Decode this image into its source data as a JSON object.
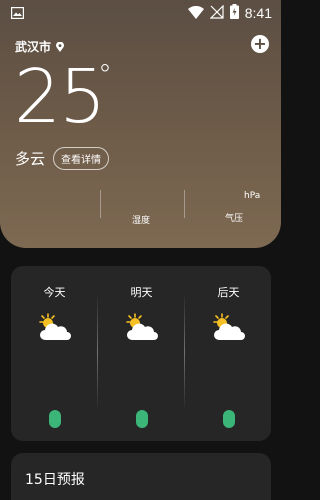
{
  "status": {
    "time": "8:41"
  },
  "location": {
    "city": "武汉市"
  },
  "current": {
    "temperature": "25",
    "degree_symbol": "°",
    "condition": "多云",
    "detail_button": "查看详情"
  },
  "stats": {
    "humidity_label": "湿度",
    "pressure_label": "气压",
    "pressure_unit": "hPa"
  },
  "forecast": {
    "days": [
      {
        "label": "今天",
        "icon": "partly-cloudy-icon"
      },
      {
        "label": "明天",
        "icon": "partly-cloudy-icon"
      },
      {
        "label": "后天",
        "icon": "partly-cloudy-icon"
      }
    ],
    "pill_color": "#3bb578"
  },
  "fifteen_day": {
    "title": "15日预报"
  }
}
